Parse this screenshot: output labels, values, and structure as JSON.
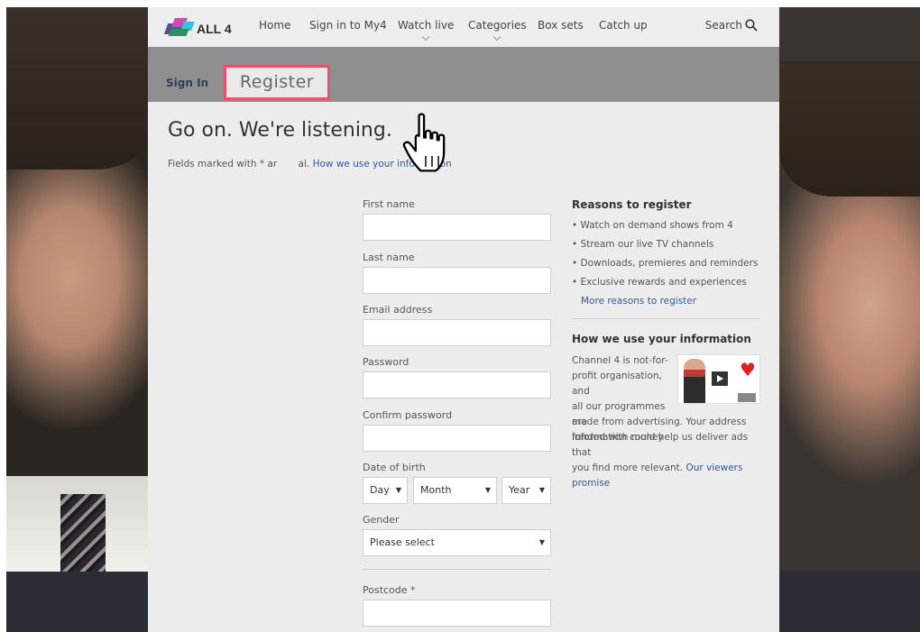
{
  "nav": {
    "logo_text": "ALL 4",
    "items": [
      {
        "label": "Home",
        "has_dropdown": false
      },
      {
        "label": "Sign in to My4",
        "has_dropdown": false
      },
      {
        "label": "Watch live",
        "has_dropdown": true
      },
      {
        "label": "Categories",
        "has_dropdown": true
      },
      {
        "label": "Box sets",
        "has_dropdown": false
      },
      {
        "label": "Catch up",
        "has_dropdown": false
      }
    ],
    "search_label": "Search",
    "search_icon": "magnifier-icon"
  },
  "tabs": {
    "signin_label": "Sign In",
    "register_label": "Register"
  },
  "page": {
    "heading": "Go on. We're listening.",
    "note_visible_start": "Fields marked with",
    "note_visible_star": "*",
    "note_visible_mid_a": "ar",
    "note_visible_mid_b": "al.",
    "note_link": "How we use your information"
  },
  "form": {
    "first_name_label": "First name",
    "first_name_value": "",
    "last_name_label": "Last name",
    "last_name_value": "",
    "email_label": "Email address",
    "email_value": "",
    "password_label": "Password",
    "password_value": "",
    "confirm_password_label": "Confirm password",
    "confirm_password_value": "",
    "dob_label": "Date of birth",
    "dob_day": "Day",
    "dob_month": "Month",
    "dob_year": "Year",
    "gender_label": "Gender",
    "gender_value": "Please select",
    "postcode_label": "Postcode",
    "postcode_required": "*",
    "postcode_value": ""
  },
  "sidebar": {
    "reasons_title": "Reasons to register",
    "reasons": [
      "Watch on demand shows from 4",
      "Stream our live TV channels",
      "Downloads, premieres and reminders",
      "Exclusive rewards and experiences"
    ],
    "more_reasons_link": "More reasons to register",
    "info_title": "How we use your information",
    "info_lines": [
      "Channel 4 is not-for-",
      "profit organisation, and",
      "all our programmes are",
      "funded with money",
      "made from advertising. Your address",
      "information could help us deliver ads that",
      "you find more relevant."
    ],
    "viewers_promise_link": "Our viewers promise"
  },
  "colors": {
    "accent_highlight": "#e05570",
    "link": "#2d5a9a",
    "subnav_bg": "#8f8f92"
  },
  "icons": {
    "cursor": "hand-pointer-icon",
    "dropdown": "chevron-down-icon",
    "select_arrow": "triangle-down-icon",
    "promo": "play-icon"
  }
}
